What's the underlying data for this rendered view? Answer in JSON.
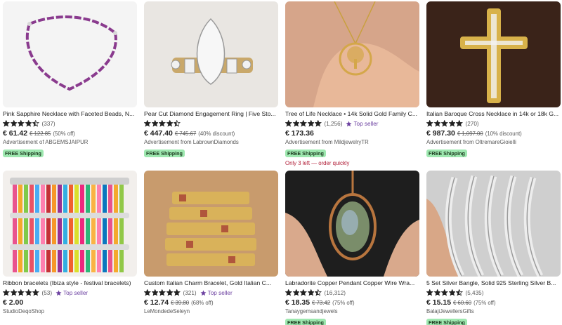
{
  "listings": [
    {
      "title": "Pink Sapphire Necklace with Faceted Beads, N...",
      "rating": 4.5,
      "reviews": "(337)",
      "star_seller": "",
      "price": "€ 61.42",
      "original": "€ 122.85",
      "discount": "(50% off)",
      "seller": "Advertisement of ABGEMSJAIPUR",
      "shipping": "FREE Shipping",
      "stock": ""
    },
    {
      "title": "Pear Cut Diamond Engagement Ring | Five Sto...",
      "rating": 4.5,
      "reviews": "",
      "star_seller": "",
      "price": "€ 447.40",
      "original": "€ 745.67",
      "discount": "(40% discount)",
      "seller": "Advertisement from LabrownDiamonds",
      "shipping": "FREE Shipping",
      "stock": ""
    },
    {
      "title": "Tree of Life Necklace • 14k Solid Gold Family C...",
      "rating": 5,
      "reviews": "(1,256)",
      "star_seller": "Top seller",
      "price": "€ 173.36",
      "original": "",
      "discount": "",
      "seller": "Advertisement from MildjewelryTR",
      "shipping": "FREE Shipping",
      "stock": "Only 3 left — order quickly"
    },
    {
      "title": "Italian Baroque Cross Necklace in 14k or 18k G...",
      "rating": 5,
      "reviews": "(270)",
      "star_seller": "",
      "price": "€ 987.30",
      "original": "€ 1,097.00",
      "discount": "(10% discount)",
      "seller": "Advertisement from OltremareGioielli",
      "shipping": "FREE Shipping",
      "stock": ""
    },
    {
      "title": "Ribbon bracelets (Ibiza style - festival bracelets)",
      "rating": 5,
      "reviews": "(53)",
      "star_seller": "Top seller",
      "price": "€ 2.00",
      "original": "",
      "discount": "",
      "seller": "StudioDeqoShop",
      "shipping": "",
      "stock": ""
    },
    {
      "title": "Custom Italian Charm Bracelet, Gold Italian C...",
      "rating": 5,
      "reviews": "(321)",
      "star_seller": "Top seller",
      "price": "€ 12.74",
      "original": "€ 39.80",
      "discount": "(68% off)",
      "seller": "LeMondedeSeleyn",
      "shipping": "",
      "stock": ""
    },
    {
      "title": "Labradorite Copper Pendant Copper Wire Wra...",
      "rating": 4.5,
      "reviews": "(16,312)",
      "star_seller": "",
      "price": "€ 18.35",
      "original": "€ 73.42",
      "discount": "(75% off)",
      "seller": "Tanaygemsandjewels",
      "shipping": "FREE Shipping",
      "stock": ""
    },
    {
      "title": "5 Set Silver Bangle, Solid 925 Sterling Silver B...",
      "rating": 4.5,
      "reviews": "(5,435)",
      "star_seller": "",
      "price": "€ 15.15",
      "original": "€ 60.60",
      "discount": "(75% off)",
      "seller": "BalajiJewellersGifts",
      "shipping": "FREE Shipping",
      "stock": ""
    }
  ],
  "colors": {
    "star": "#222222",
    "badge": "#9ee8b0",
    "star_seller": "#6b3fa0",
    "stock": "#b2213a"
  },
  "icons": {
    "rating": "star-icon",
    "star_seller": "star-seller-icon"
  }
}
